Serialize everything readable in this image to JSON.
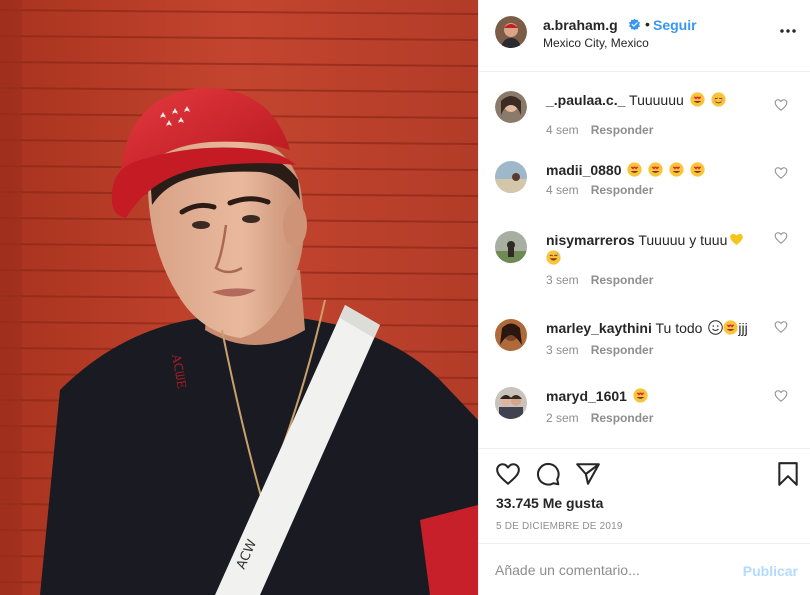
{
  "post": {
    "username": "a.braham.g",
    "verified": true,
    "separator": "•",
    "follow_label": "Seguir",
    "location": "Mexico City, Mexico",
    "more_icon": "more-options-icon"
  },
  "photo": {
    "cap_color": "#d5232a",
    "wall_color": "#b83a2a",
    "sweater_color": "#1a1b22",
    "strap_color": "#f1f1ef",
    "strap_text": "ACW"
  },
  "comments": [
    {
      "user": "_.paulaa.c._",
      "text": "Tuuuuuu",
      "emojis": [
        "heart-eyes",
        "relieved"
      ],
      "time": "4 sem",
      "reply": "Responder"
    },
    {
      "user": "madii_0880",
      "text": "",
      "emojis": [
        "heart-eyes",
        "heart-eyes",
        "heart-eyes",
        "heart-eyes"
      ],
      "time": "4 sem",
      "reply": "Responder"
    },
    {
      "user": "nisymarreros",
      "text": "Tuuuuu y tuuu",
      "emojis": [
        "yellow-heart",
        "sweat-smile"
      ],
      "time": "3 sem",
      "reply": "Responder"
    },
    {
      "user": "marley_kaythini",
      "text": "Tu todo",
      "emojis": [
        "smiley",
        "heart-eyes"
      ],
      "suffix": "jjj",
      "time": "3 sem",
      "reply": "Responder"
    },
    {
      "user": "maryd_1601",
      "text": "",
      "emojis": [
        "heart-eyes"
      ],
      "time": "2 sem",
      "reply": "Responder"
    }
  ],
  "actions": {
    "like_icon": "heart-icon",
    "comment_icon": "comment-icon",
    "share_icon": "share-icon",
    "save_icon": "bookmark-icon",
    "likes": "33.745 Me gusta",
    "date": "5 DE DICIEMBRE DE 2019"
  },
  "composer": {
    "placeholder": "Añade un comentario...",
    "publish_label": "Publicar"
  },
  "colors": {
    "link_blue": "#3897f0",
    "publish_disabled": "#b3dbff",
    "muted": "#8e8e8e",
    "text": "#262626"
  }
}
